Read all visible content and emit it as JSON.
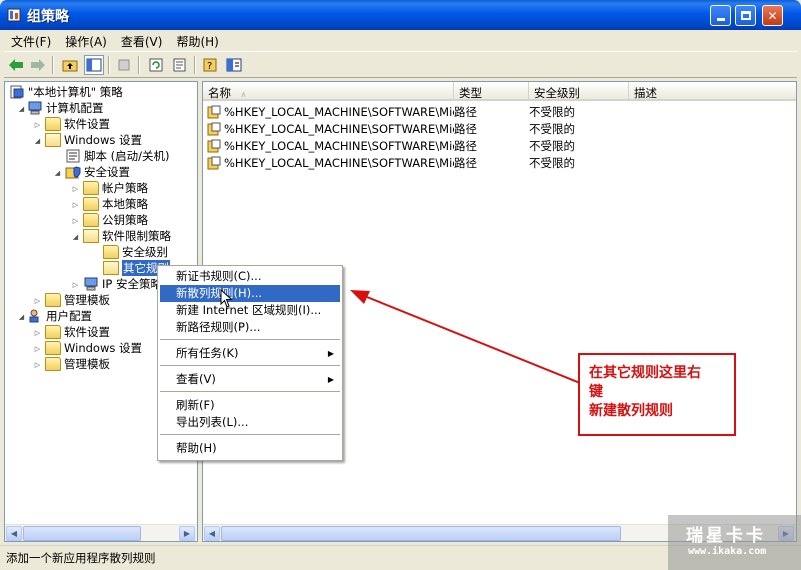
{
  "window": {
    "title": "组策略"
  },
  "menubar": [
    "文件(F)",
    "操作(A)",
    "查看(V)",
    "帮助(H)"
  ],
  "tree": [
    {
      "label": "\"本地计算机\" 策略",
      "icon": "policy-icon"
    },
    {
      "label": "计算机配置",
      "icon": "computer-icon"
    },
    {
      "label": "软件设置",
      "icon": "folder-icon"
    },
    {
      "label": "Windows 设置",
      "icon": "folder-icon"
    },
    {
      "label": "脚本 (启动/关机)",
      "icon": "script-icon"
    },
    {
      "label": "安全设置",
      "icon": "security-icon"
    },
    {
      "label": "帐户策略",
      "icon": "folder-icon"
    },
    {
      "label": "本地策略",
      "icon": "folder-icon"
    },
    {
      "label": "公钥策略",
      "icon": "folder-icon"
    },
    {
      "label": "软件限制策略",
      "icon": "folder-icon"
    },
    {
      "label": "安全级别",
      "icon": "folder-icon"
    },
    {
      "label": "其它规则",
      "icon": "folder-open-icon"
    },
    {
      "label": "IP 安全策略",
      "icon": "ip-security-icon"
    },
    {
      "label": "管理模板",
      "icon": "folder-icon"
    },
    {
      "label": "用户配置",
      "icon": "user-icon"
    },
    {
      "label": "软件设置",
      "icon": "folder-icon"
    },
    {
      "label": "Windows 设置",
      "icon": "folder-icon"
    },
    {
      "label": "管理模板",
      "icon": "folder-icon"
    }
  ],
  "list": {
    "columns": [
      "名称",
      "类型",
      "安全级别",
      "描述"
    ],
    "rows": [
      {
        "name": "%HKEY_LOCAL_MACHINE\\SOFTWARE\\Micr...",
        "type": "路径",
        "security": "不受限的",
        "desc": ""
      },
      {
        "name": "%HKEY_LOCAL_MACHINE\\SOFTWARE\\Micr...",
        "type": "路径",
        "security": "不受限的",
        "desc": ""
      },
      {
        "name": "%HKEY_LOCAL_MACHINE\\SOFTWARE\\Micr...",
        "type": "路径",
        "security": "不受限的",
        "desc": ""
      },
      {
        "name": "%HKEY_LOCAL_MACHINE\\SOFTWARE\\Micr...",
        "type": "路径",
        "security": "不受限的",
        "desc": ""
      }
    ]
  },
  "context_menu": {
    "items": [
      "新证书规则(C)...",
      "新散列规则(H)...",
      "新建 Internet 区域规则(I)...",
      "新路径规则(P)...",
      "所有任务(K)",
      "查看(V)",
      "刷新(F)",
      "导出列表(L)...",
      "帮助(H)"
    ]
  },
  "status": {
    "text": "添加一个新应用程序散列规则"
  },
  "annotation": {
    "line1": "在其它规则这里右",
    "line2": "键",
    "line3": "新建散列规则"
  },
  "watermark": {
    "title": "瑞星卡卡",
    "url": "www.ikaka.com"
  },
  "colors": {
    "selection": "#316ac5",
    "annotation": "#d61010",
    "titlebar": "#0058e6"
  }
}
